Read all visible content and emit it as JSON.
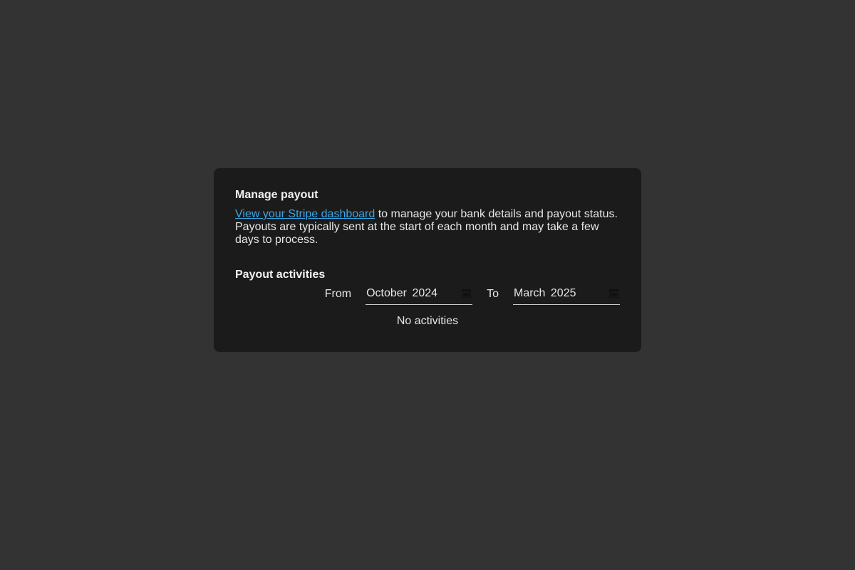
{
  "payout": {
    "title": "Manage payout",
    "link_text": "View your Stripe dashboard",
    "description_rest": " to manage your bank details and payout status. Payouts are typically sent at the start of each month and may take a few days to process."
  },
  "activities": {
    "title": "Payout activities",
    "from_label": "From",
    "from_value": "October 2024",
    "to_label": "To",
    "to_value": "March 2025",
    "empty_text": "No activities"
  },
  "colors": {
    "page_bg": "#333333",
    "card_bg": "#1b1b1b",
    "link": "#3aa7e8"
  }
}
